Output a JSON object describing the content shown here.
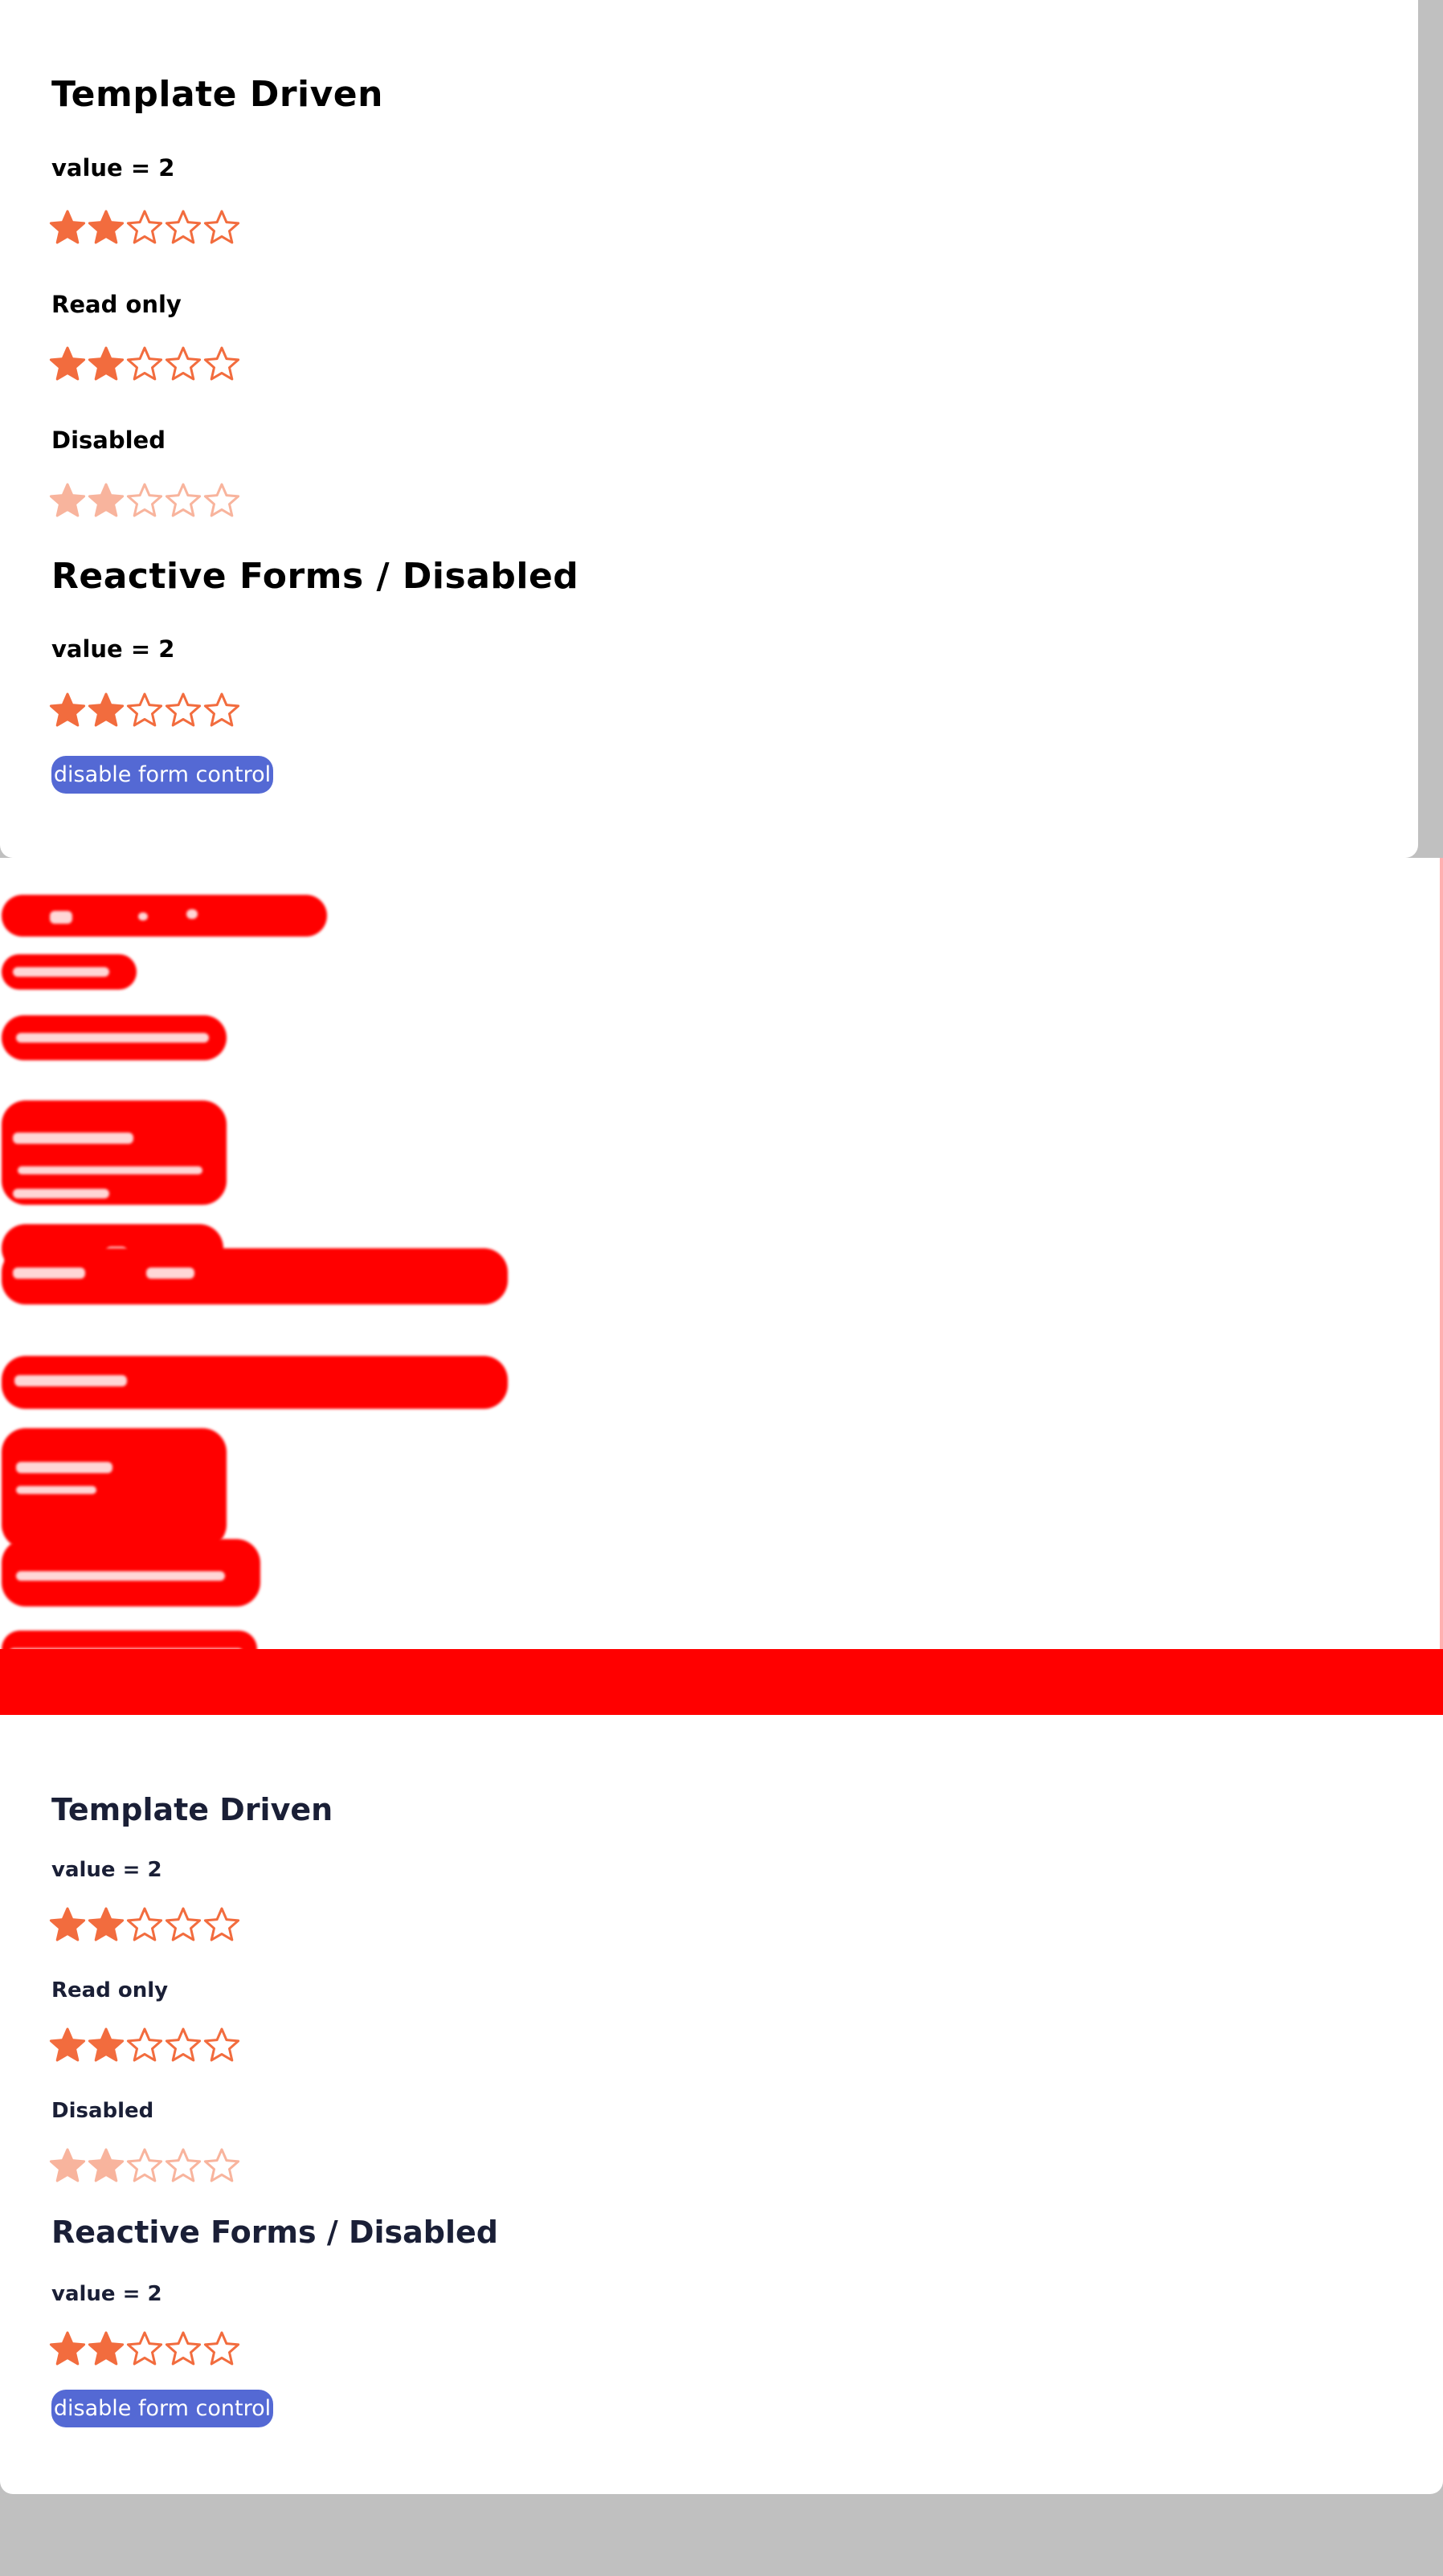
{
  "colors": {
    "star": "#f26c3e",
    "button": "#5469d4",
    "diff": "#ff0000"
  },
  "top": {
    "template_title": "Template Driven",
    "value_label": "value = 2",
    "readonly_label": "Read only",
    "disabled_label": "Disabled",
    "reactive_title": "Reactive Forms / Disabled",
    "reactive_value_label": "value = 2",
    "button_label": "disable form control"
  },
  "bottom": {
    "template_title": "Template Driven",
    "value_label": "value = 2",
    "readonly_label": "Read only",
    "disabled_label": "Disabled",
    "reactive_title": "Reactive Forms / Disabled",
    "reactive_value_label": "value = 2",
    "button_label": "disable form control"
  },
  "ratings": {
    "value": 2,
    "max": 5
  }
}
